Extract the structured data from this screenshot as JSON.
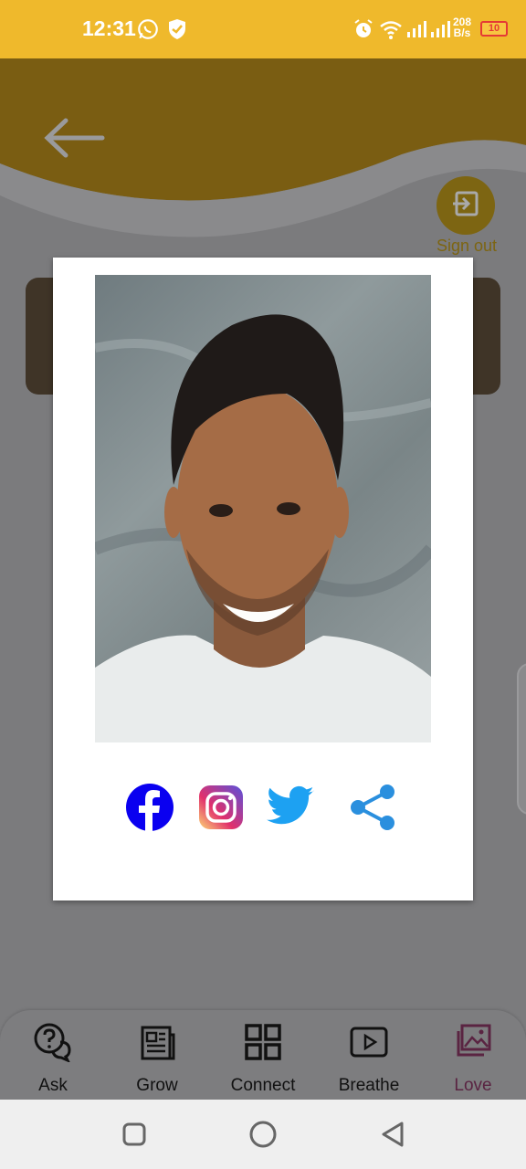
{
  "status_bar": {
    "time": "12:31",
    "net_speed_value": "208",
    "net_speed_unit": "B/s",
    "battery": "10",
    "icons": [
      "whatsapp-icon",
      "shield-check-icon",
      "alarm-icon",
      "wifi-icon",
      "signal-icon",
      "signal-icon"
    ]
  },
  "header": {
    "back_icon": "arrow-left-icon",
    "signout_label": "Sign out",
    "signout_icon": "logout-icon"
  },
  "dialog": {
    "photo_icon": "profile-photo",
    "social": [
      {
        "name": "facebook-icon",
        "color": "#1877f2"
      },
      {
        "name": "instagram-icon",
        "color": "#c13584"
      },
      {
        "name": "twitter-icon",
        "color": "#1da1f2"
      },
      {
        "name": "share-icon",
        "color": "#2a8fde"
      }
    ]
  },
  "bottom_nav": {
    "items": [
      {
        "label": "Ask",
        "icon": "question-chat-icon"
      },
      {
        "label": "Grow",
        "icon": "newspaper-icon"
      },
      {
        "label": "Connect",
        "icon": "grid-icon"
      },
      {
        "label": "Breathe",
        "icon": "play-icon"
      },
      {
        "label": "Love",
        "icon": "gallery-icon"
      }
    ],
    "active": "Love"
  },
  "colors": {
    "status_bar": "#efb92c",
    "header_dim": "#7a5d12",
    "overlay": "#7b7b7d",
    "active_nav": "#5a2442"
  }
}
